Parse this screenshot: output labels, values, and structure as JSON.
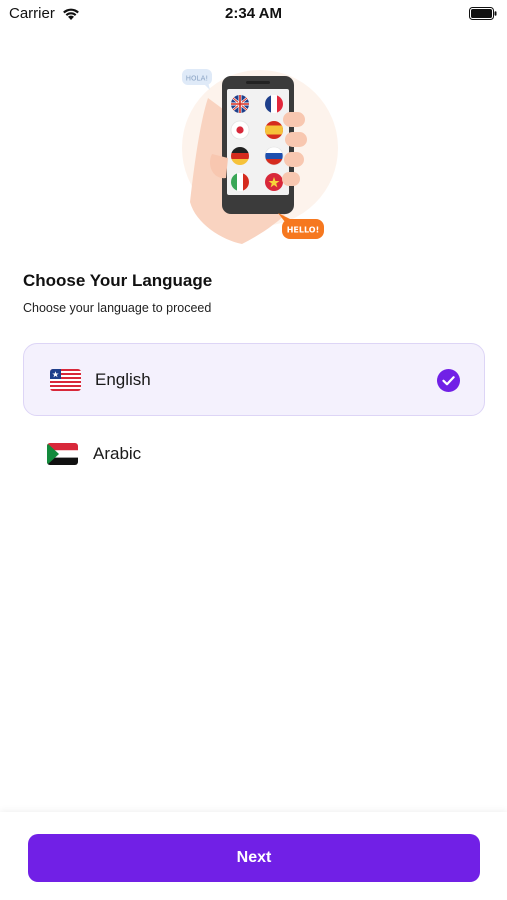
{
  "status_bar": {
    "carrier": "Carrier",
    "time": "2:34 AM",
    "battery_level": 0.95
  },
  "illustration": {
    "bubble_top": "HOLA!",
    "bubble_bottom": "HELLO!",
    "flags": [
      "uk",
      "france",
      "japan",
      "spain",
      "germany",
      "russia",
      "italy",
      "vietnam"
    ]
  },
  "header": {
    "title": "Choose Your Language",
    "subtitle": "Choose your language to proceed"
  },
  "languages": [
    {
      "label": "English",
      "flag_icon": "liberia-flag-icon",
      "selected": true
    },
    {
      "label": "Arabic",
      "flag_icon": "sudan-flag-icon",
      "selected": false
    }
  ],
  "footer": {
    "next_label": "Next"
  },
  "colors": {
    "accent": "#7120e6",
    "selected_bg": "#f4f1fd",
    "selected_border": "#ddd5f6",
    "bubble_orange": "#f6781f"
  }
}
